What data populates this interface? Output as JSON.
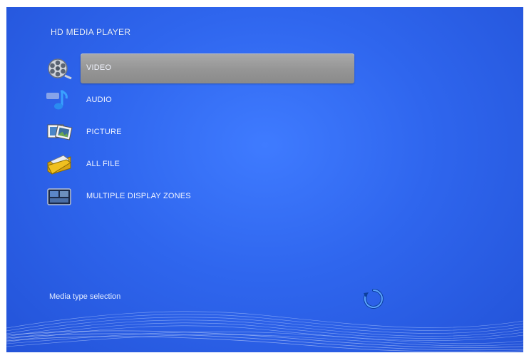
{
  "header": {
    "title": "HD MEDIA PLAYER"
  },
  "menu": {
    "items": [
      {
        "label": "VIDEO",
        "icon": "film-reel-icon",
        "selected": true
      },
      {
        "label": "AUDIO",
        "icon": "music-note-icon",
        "selected": false
      },
      {
        "label": "PICTURE",
        "icon": "photos-icon",
        "selected": false
      },
      {
        "label": "ALL FILE",
        "icon": "folder-icon",
        "selected": false
      },
      {
        "label": "MULTIPLE DISPLAY ZONES",
        "icon": "display-zones-icon",
        "selected": false
      }
    ]
  },
  "status": {
    "text": "Media type selection"
  },
  "colors": {
    "background": "#2f66ee",
    "highlight": "#9a9a9a",
    "text": "#f2f5ff"
  }
}
